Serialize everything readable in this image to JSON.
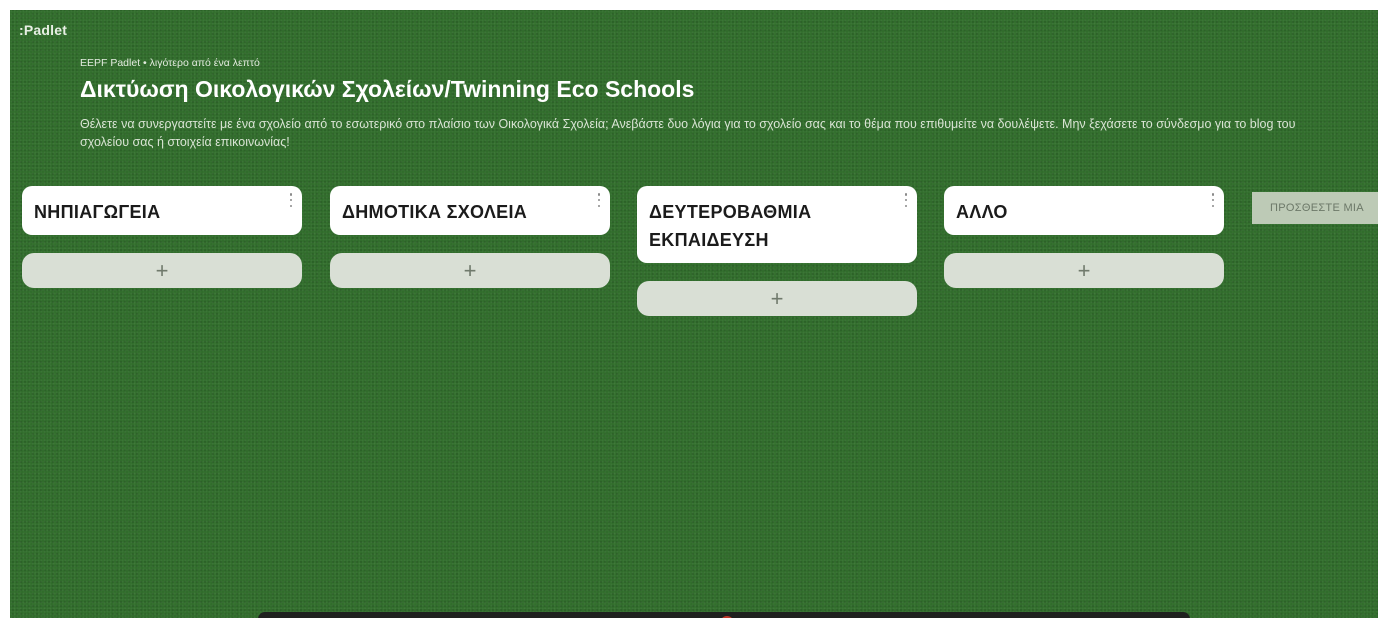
{
  "app": {
    "logo": ":Padlet"
  },
  "header": {
    "meta": "EEPF Padlet • λιγότερο από ένα λεπτό",
    "title": "Δικτύωση Οικολογικών Σχολείων/Twinning Eco Schools",
    "description": "Θέλετε να συνεργαστείτε με ένα σχολείο από το εσωτερικό στο πλαίσιο των Οικολογικά Σχολεία; Ανεβάστε δυο λόγια για το σχολείο σας και το θέμα που επιθυμείτε να δουλέψετε. Μην ξεχάσετε το σύνδεσμο για το blog του σχολείου σας ή στοιχεία επικοινωνίας!"
  },
  "columns": [
    {
      "title": "ΝΗΠΙΑΓΩΓΕΙΑ",
      "add_label": "+",
      "menu_icon": "kebab-menu-icon"
    },
    {
      "title": "ΔΗΜΟΤΙΚΑ ΣΧΟΛΕΙΑ",
      "add_label": "+",
      "menu_icon": "kebab-menu-icon"
    },
    {
      "title": "ΔΕΥΤΕΡΟΒΑΘΜΙΑ ΕΚΠΑΙΔΕΥΣΗ",
      "add_label": "+",
      "menu_icon": "kebab-menu-icon"
    },
    {
      "title": "ΑΛΛΟ",
      "add_label": "+",
      "menu_icon": "kebab-menu-icon"
    }
  ],
  "add_section": {
    "label": "ΠΡΟΣΘΕΣΤΕ ΜΙΑ"
  },
  "colors": {
    "background": "#2f6b2a",
    "header_card": "#ffffff",
    "add_button": "#d9dfd5",
    "add_section": "#bdcab6"
  }
}
